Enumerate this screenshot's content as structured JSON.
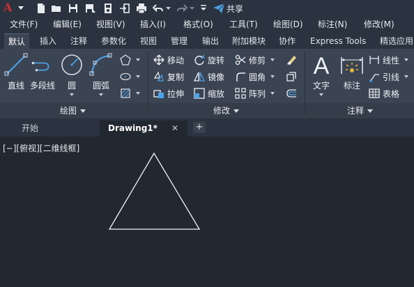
{
  "app": {
    "logo_text": "A",
    "share_label": "共享"
  },
  "menu": [
    {
      "label": "文件(F)"
    },
    {
      "label": "编辑(E)"
    },
    {
      "label": "视图(V)"
    },
    {
      "label": "插入(I)"
    },
    {
      "label": "格式(O)"
    },
    {
      "label": "工具(T)"
    },
    {
      "label": "绘图(D)"
    },
    {
      "label": "标注(N)"
    },
    {
      "label": "修改(M)"
    }
  ],
  "ribbon_tabs": [
    {
      "label": "默认",
      "active": true
    },
    {
      "label": "插入"
    },
    {
      "label": "注释"
    },
    {
      "label": "参数化"
    },
    {
      "label": "视图"
    },
    {
      "label": "管理"
    },
    {
      "label": "输出"
    },
    {
      "label": "附加模块"
    },
    {
      "label": "协作"
    },
    {
      "label": "Express Tools"
    },
    {
      "label": "精选应用"
    }
  ],
  "panels": {
    "draw": {
      "title": "绘图",
      "tools": {
        "line": "直线",
        "polyline": "多段线",
        "circle": "圆",
        "arc": "圆弧"
      }
    },
    "modify": {
      "title": "修改",
      "tools": {
        "move": "移动",
        "rotate": "旋转",
        "trim": "修剪",
        "copy": "复制",
        "mirror": "镜像",
        "fillet": "圆角",
        "stretch": "拉伸",
        "scale": "缩放",
        "array": "阵列"
      }
    },
    "annotation": {
      "title": "注释",
      "tools": {
        "text": "文字",
        "dimension": "标注",
        "linear": "线性",
        "leader": "引线",
        "table": "表格"
      }
    }
  },
  "file_tabs": [
    {
      "label": "开始"
    },
    {
      "label": "Drawing1*",
      "active": true
    }
  ],
  "viewport": {
    "label": "[−][俯视][二维线框]"
  },
  "colors": {
    "background": "#212830",
    "ribbon": "#3b4453",
    "toolbar": "#2b3340",
    "accent_blue": "#4da3e8",
    "logo_red": "#d22d2d"
  }
}
